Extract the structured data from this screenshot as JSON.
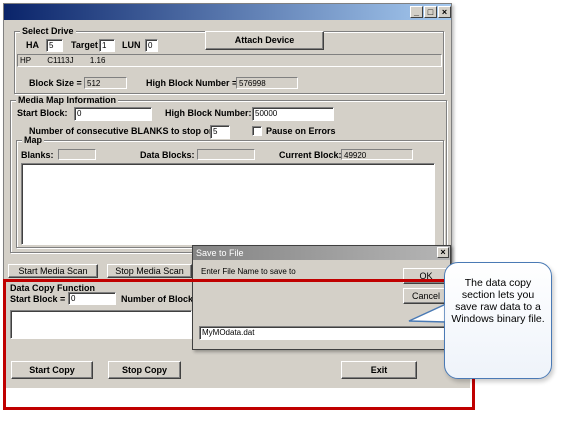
{
  "window": {
    "minimize": "_",
    "maximize": "□",
    "close": "×"
  },
  "select_drive": {
    "group_label": "Select Drive",
    "ha_label": "HA",
    "ha_value": "5",
    "target_label": "Target",
    "target_value": "1",
    "lun_label": "LUN",
    "lun_value": "0",
    "attach_button": "Attach Device",
    "device_vendor": "HP",
    "device_model": "C1113J",
    "device_rev": "1.16",
    "block_size_label": "Block Size =",
    "block_size_value": "512",
    "high_block_label": "High Block Number =",
    "high_block_value": "576998"
  },
  "media_map": {
    "group_label": "Media Map Information",
    "start_block_label": "Start Block:",
    "start_block_value": "0",
    "high_block_label": "High Block Number:",
    "high_block_value": "50000",
    "blanks_stop_label": "Number of consecutive BLANKS to stop on:",
    "blanks_stop_value": "5",
    "pause_label": "Pause on Errors",
    "map_label": "Map",
    "blanks_label": "Blanks:",
    "blanks_value": "",
    "data_blocks_label": "Data Blocks:",
    "data_blocks_value": "",
    "current_block_label": "Current Block:",
    "current_block_value": "49920"
  },
  "scan_buttons": {
    "start": "Start Media Scan",
    "stop": "Stop Media Scan"
  },
  "data_copy": {
    "group_label": "Data Copy Function",
    "start_block_label": "Start Block =",
    "start_block_value": "0",
    "num_blocks_label": "Number of Blocks",
    "start_copy": "Start Copy",
    "stop_copy": "Stop Copy",
    "exit": "Exit"
  },
  "save_dialog": {
    "title": "Save to File",
    "close": "×",
    "prompt": "Enter File Name to save to",
    "ok": "OK",
    "cancel": "Cancel",
    "filename": "MyMOdata.dat"
  },
  "callout": {
    "text": "The data copy section lets you save raw data to a Windows binary file."
  },
  "colors": {
    "highlight_border": "#c00000",
    "callout_border": "#4a7ab5",
    "titlebar_active": "#0a246a"
  }
}
